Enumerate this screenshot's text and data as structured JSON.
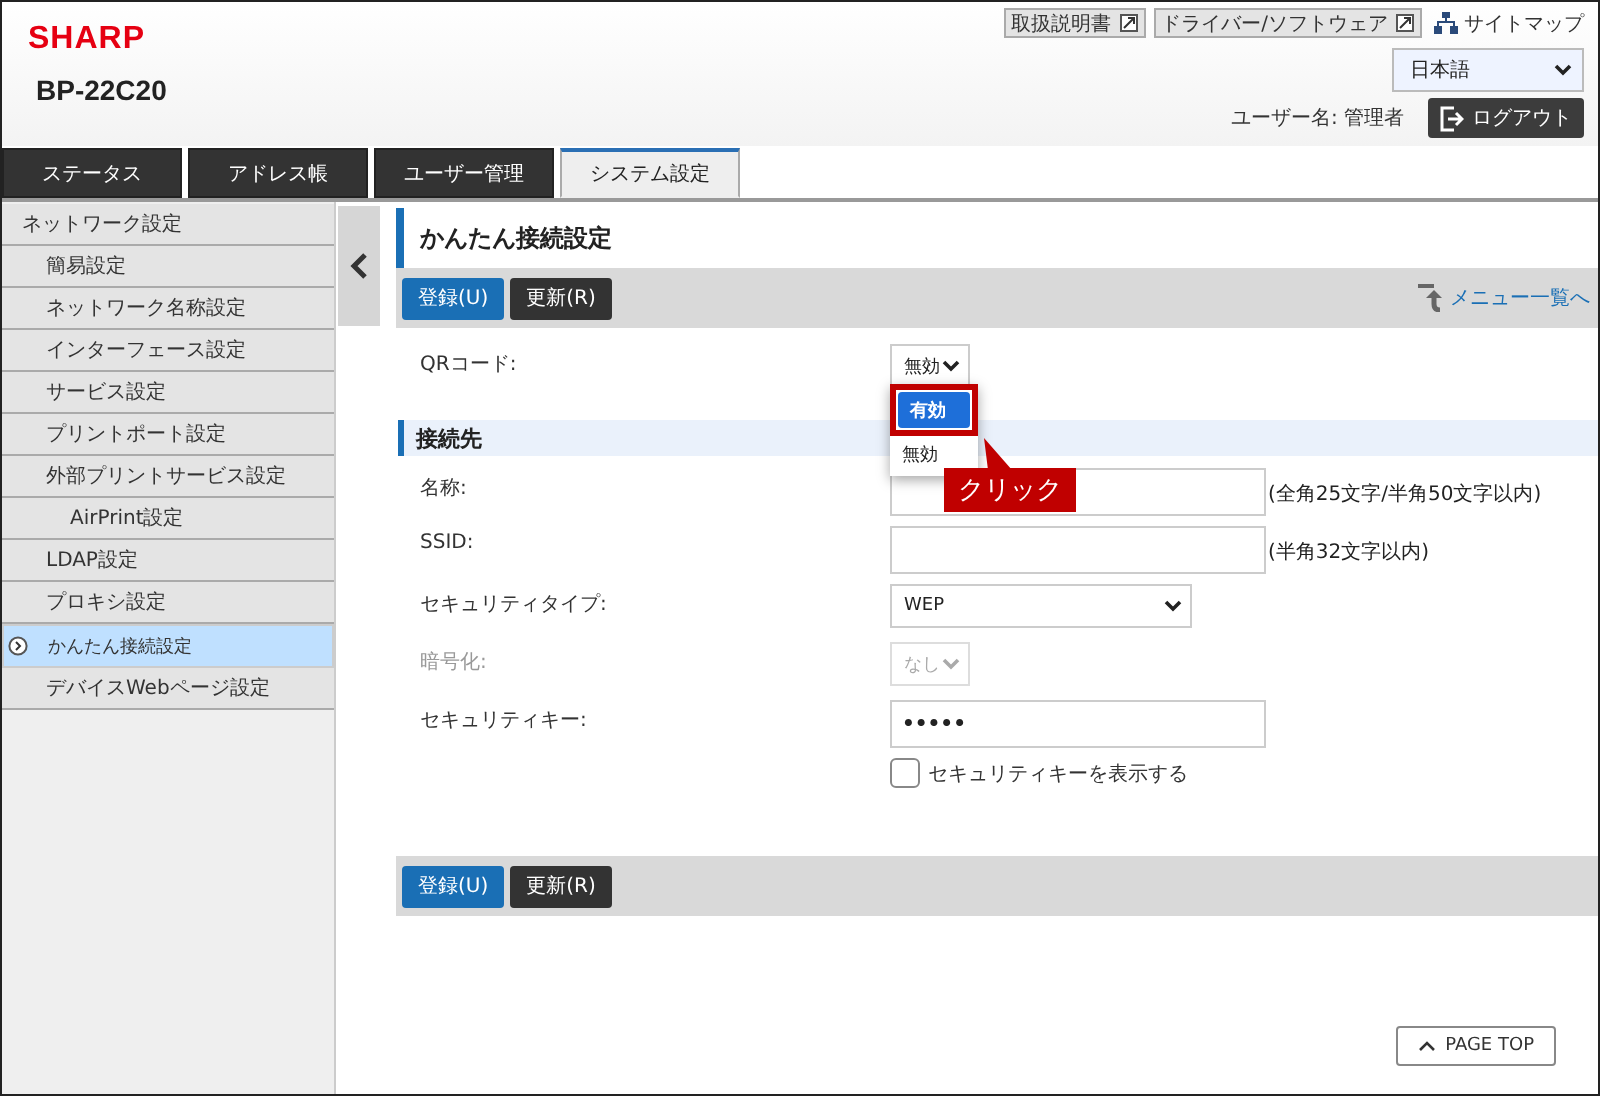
{
  "header": {
    "logo": "SHARP",
    "model": "BP-22C20",
    "links": [
      {
        "label": "取扱説明書"
      },
      {
        "label": "ドライバー/ソフトウェア"
      }
    ],
    "sitemap": "サイトマップ",
    "language": "日本語",
    "user": "ユーザー名: 管理者",
    "logout": "ログアウト"
  },
  "tabs": [
    {
      "label": "ステータス",
      "selected": false
    },
    {
      "label": "アドレス帳",
      "selected": false
    },
    {
      "label": "ユーザー管理",
      "selected": false
    },
    {
      "label": "システム設定",
      "selected": true
    }
  ],
  "sidebar": {
    "items": [
      {
        "label": "ネットワーク設定",
        "selected": false,
        "children": [
          {
            "label": "簡易設定",
            "selected": false
          },
          {
            "label": "ネットワーク名称設定",
            "selected": false
          },
          {
            "label": "インターフェース設定",
            "selected": false
          },
          {
            "label": "サービス設定",
            "selected": false
          },
          {
            "label": "プリントポート設定",
            "selected": false
          },
          {
            "label": "外部プリントサービス設定",
            "selected": false,
            "children": [
              {
                "label": "AirPrint設定",
                "selected": false
              }
            ]
          },
          {
            "label": "LDAP設定",
            "selected": false
          },
          {
            "label": "プロキシ設定",
            "selected": false
          },
          {
            "label": "かんたん接続設定",
            "selected": true
          },
          {
            "label": "デバイスWebページ設定",
            "selected": false
          }
        ]
      }
    ]
  },
  "page": {
    "title": "かんたん接続設定",
    "buttons": [
      {
        "label": "登録(U)",
        "kind": "primary"
      },
      {
        "label": "更新(R)",
        "kind": "secondary"
      }
    ],
    "menu_link": "メニュー一覧へ",
    "qr": {
      "label": "QRコード:",
      "value": "無効",
      "options": [
        {
          "label": "有効",
          "highlighted": true
        },
        {
          "label": "無効",
          "highlighted": false
        }
      ]
    },
    "callout": "クリック",
    "section": "接続先",
    "fields": [
      {
        "kind": "text",
        "label": "名称:",
        "hint": "(全角25文字/半角50文字以内)",
        "disabled": false
      },
      {
        "kind": "text",
        "label": "SSID:",
        "hint": "(半角32文字以内)",
        "disabled": false
      },
      {
        "kind": "wide-select",
        "label": "セキュリティタイプ:",
        "value": "WEP",
        "disabled": false
      },
      {
        "kind": "small-select",
        "label": "暗号化:",
        "value": "なし",
        "disabled": true
      },
      {
        "kind": "password",
        "label": "セキュリティキー:",
        "value": "•••••",
        "disabled": false
      }
    ],
    "show_key": {
      "label": "セキュリティキーを表示する",
      "checked": false
    },
    "bottom_buttons": [
      {
        "label": "登録(U)",
        "kind": "primary"
      },
      {
        "label": "更新(R)",
        "kind": "secondary"
      }
    ],
    "page_top": "PAGE TOP"
  }
}
